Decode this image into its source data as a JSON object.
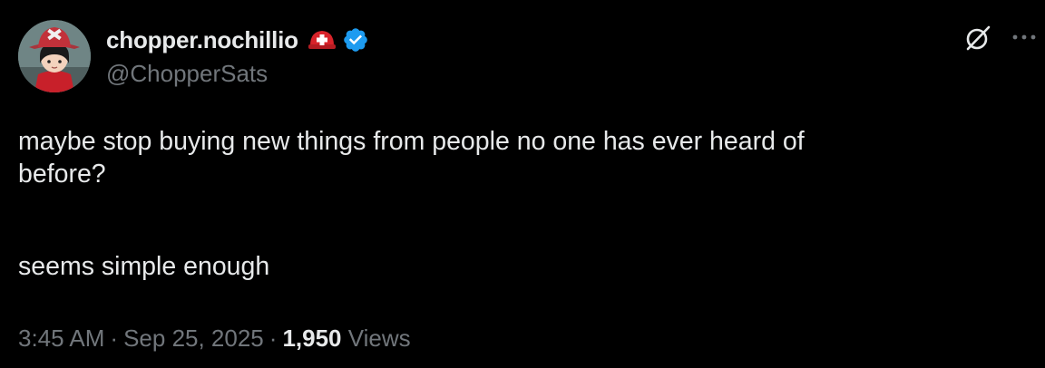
{
  "author": {
    "display_name": "chopper.nochillio",
    "handle": "@ChopperSats",
    "verified": true,
    "verified_color": "#1d9bf0",
    "name_emoji": "rescue-worker-helmet-icon",
    "avatar": "avatar-chopper-character"
  },
  "tweet": {
    "line1": "maybe stop buying new things from people no one has ever heard of",
    "line2": "before?",
    "line3": "seems simple enough"
  },
  "meta": {
    "time": "3:45 AM",
    "separator": "·",
    "date": "Sep 25, 2025",
    "views_count": "1,950",
    "views_label": "Views"
  },
  "actions": {
    "grok_icon": "grok-icon",
    "more_icon": "more-icon"
  },
  "colors": {
    "background": "#000000",
    "primary_text": "#e7e9ea",
    "secondary_text": "#71767b"
  }
}
